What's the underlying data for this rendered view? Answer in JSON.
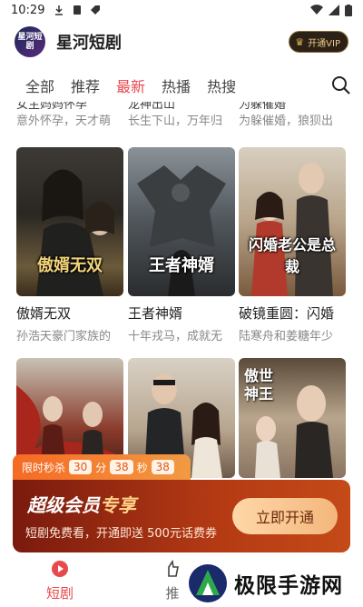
{
  "status": {
    "time": "10:29"
  },
  "app": {
    "title": "星河短剧",
    "logo_text": "星河短剧",
    "vip_label": "开通VIP"
  },
  "tabs": [
    "全部",
    "推荐",
    "最新",
    "热播",
    "热搜"
  ],
  "active_tab": 2,
  "prev_row": [
    {
      "title": "女主妈妈怀孕",
      "sub": "意外怀孕，天才萌"
    },
    {
      "title": "龙神出山",
      "sub": "长生下山，万年归"
    },
    {
      "title": "为躲催婚",
      "sub": "为躲催婚，狼狈出"
    }
  ],
  "cards": [
    {
      "poster_text": "傲婿无双",
      "title": "傲婿无双",
      "sub": "孙浩天豪门家族的"
    },
    {
      "poster_text": "王者神婿",
      "title": "王者神婿",
      "sub": "十年戎马，成就无"
    },
    {
      "poster_text": "闪婚老公是总裁",
      "title": "破镜重圆：闪婚",
      "sub": "陆寒舟和姜糖年少"
    }
  ],
  "cards_row2": [
    {
      "poster_text": ""
    },
    {
      "poster_text": ""
    },
    {
      "poster_text": "傲世神王"
    }
  ],
  "flash_sale": {
    "label": "限时秒杀",
    "hours": "30",
    "h_unit": "分",
    "minutes": "38",
    "m_unit": "秒",
    "seconds": "38"
  },
  "vip_banner": {
    "title_a": "超级会员",
    "title_b": "专享",
    "subtitle": "短剧免费看，开通即送 500元话费券",
    "button": "立即开通"
  },
  "bottom_nav": [
    {
      "label": "短剧",
      "icon": "play-icon"
    },
    {
      "label": "推",
      "icon": "recommend-icon"
    }
  ],
  "watermark": {
    "text": "极限手游网"
  },
  "colors": {
    "accent": "#e8494d",
    "vip_gold": "#f0c986",
    "banner_orange": "#f56a24"
  }
}
